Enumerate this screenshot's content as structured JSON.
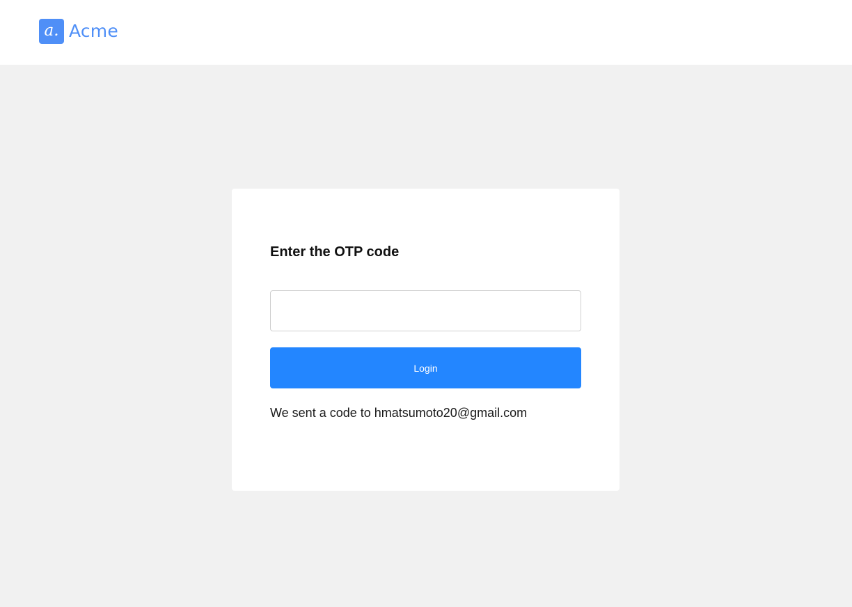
{
  "header": {
    "brand_mark": "a.",
    "brand_name": "Acme",
    "brand_color": "#4f8ff7"
  },
  "otp_form": {
    "title": "Enter the OTP code",
    "input_value": "",
    "input_placeholder": "",
    "login_label": "Login",
    "login_color": "#2386ff",
    "sent_note": "We sent a code to hmatsumoto20@gmail.com"
  },
  "colors": {
    "page_background": "#f1f1f1",
    "card_background": "#ffffff"
  }
}
